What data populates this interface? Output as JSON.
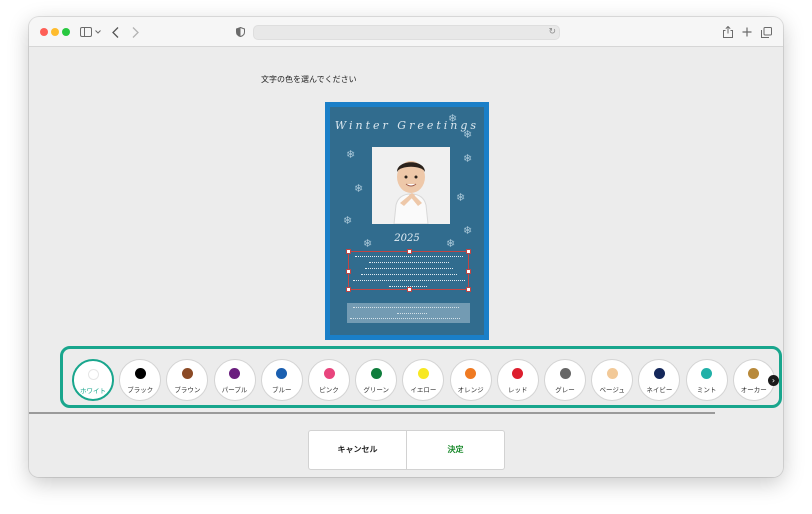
{
  "instruction": "文字の色を選んでください",
  "card": {
    "greeting": "Winter Greetings",
    "year": "2025"
  },
  "palette": {
    "selected": "ホワイト",
    "colors": [
      {
        "label": "ホワイト",
        "color": "#ffffff"
      },
      {
        "label": "ブラック",
        "color": "#000000"
      },
      {
        "label": "ブラウン",
        "color": "#8b4a25"
      },
      {
        "label": "パープル",
        "color": "#6a1e7e"
      },
      {
        "label": "ブルー",
        "color": "#1a5fb0"
      },
      {
        "label": "ピンク",
        "color": "#e8457d"
      },
      {
        "label": "グリーン",
        "color": "#0f7d3c"
      },
      {
        "label": "イエロー",
        "color": "#f7e823"
      },
      {
        "label": "オレンジ",
        "color": "#ef7a22"
      },
      {
        "label": "レッド",
        "color": "#dd1e2e"
      },
      {
        "label": "グレー",
        "color": "#666666"
      },
      {
        "label": "ベージュ",
        "color": "#f2c998"
      },
      {
        "label": "ネイビー",
        "color": "#14275a"
      },
      {
        "label": "ミント",
        "color": "#21b0a8"
      },
      {
        "label": "オーカー",
        "color": "#b8893a"
      }
    ]
  },
  "buttons": {
    "cancel": "キャンセル",
    "confirm": "決定"
  },
  "icons": [
    "sidebar-icon",
    "chevron-down-icon",
    "back-icon",
    "forward-icon",
    "shield-icon",
    "reload-icon",
    "share-icon",
    "plus-icon",
    "tabs-icon",
    "next-arrow-icon"
  ]
}
